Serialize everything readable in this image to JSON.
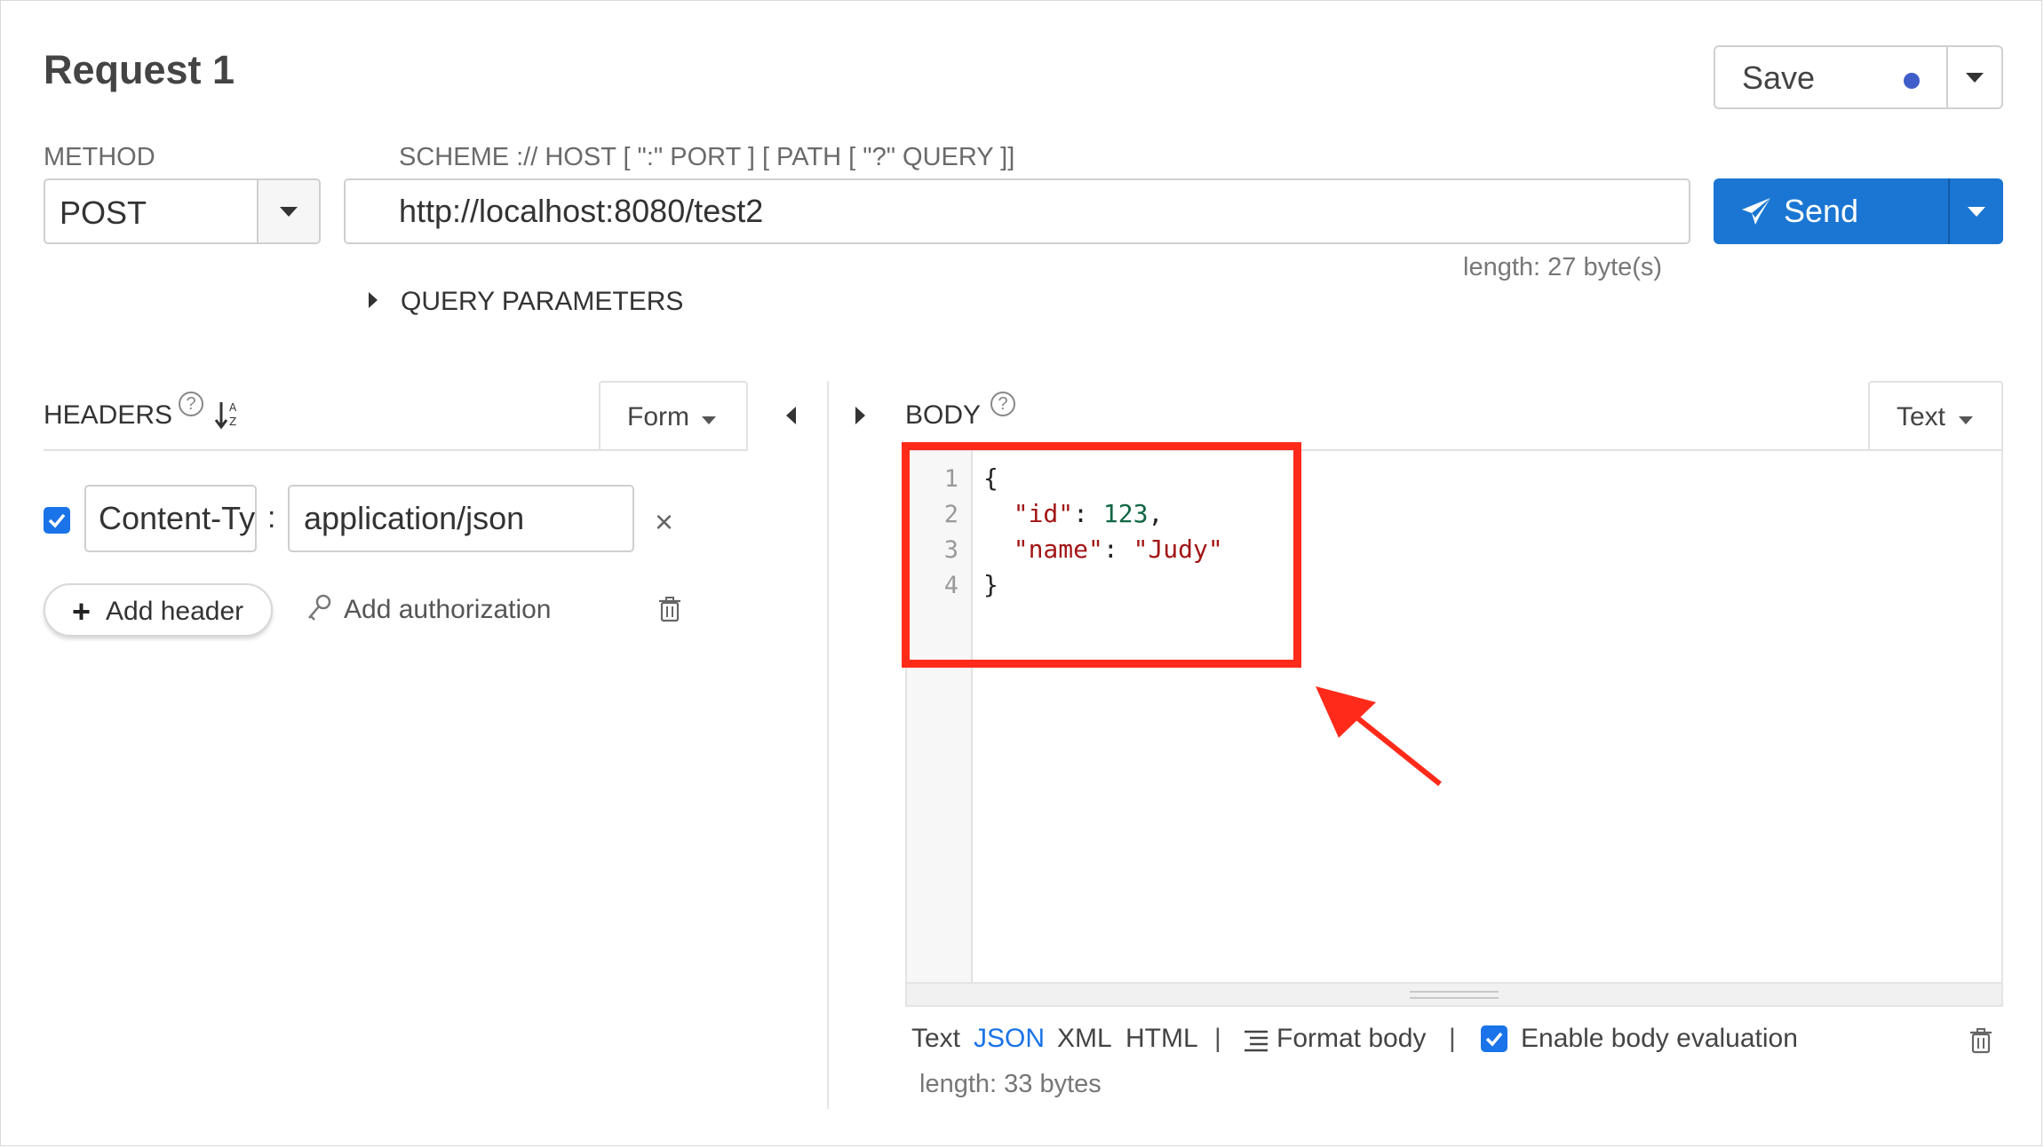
{
  "request": {
    "title": "Request 1",
    "save_label": "Save",
    "method_label": "METHOD",
    "method_value": "POST",
    "scheme_label": "SCHEME :// HOST [ \":\" PORT ] [ PATH [ \"?\" QUERY ]]",
    "url_value": "http://localhost:8080/test2",
    "url_length": "length: 27 byte(s)",
    "send_label": "Send",
    "query_params_label": "QUERY PARAMETERS"
  },
  "headers": {
    "title": "HEADERS",
    "help": "?",
    "mode_label": "Form",
    "rows": [
      {
        "enabled": true,
        "key": "Content-Type",
        "value": "application/json",
        "remove": "×"
      }
    ],
    "add_header_label": "Add header",
    "add_auth_label": "Add authorization"
  },
  "body": {
    "title": "BODY",
    "help": "?",
    "type_label": "Text",
    "line_numbers": [
      "1",
      "2",
      "3",
      "4"
    ],
    "code": {
      "open": "{",
      "id_key": "\"id\"",
      "id_value": "123",
      "name_key": "\"name\"",
      "name_value": "\"Judy\"",
      "close": "}"
    },
    "formats": {
      "text": "Text",
      "json": "JSON",
      "xml": "XML",
      "html": "HTML"
    },
    "separator": "|",
    "format_body_label": "Format body",
    "enable_eval_label": "Enable body evaluation",
    "length": "length: 33 bytes"
  },
  "icons": {
    "save_status": "status-dot-icon",
    "send": "paper-plane-icon",
    "sort": "sort-alpha-icon",
    "auth": "key-icon",
    "trash": "trash-icon",
    "format": "align-lines-icon"
  },
  "colors": {
    "primary": "#1a76d2",
    "accent_blue": "#1a73e8",
    "highlight_red": "#ff2a1a",
    "json_string": "#a31515",
    "json_number": "#116644"
  }
}
